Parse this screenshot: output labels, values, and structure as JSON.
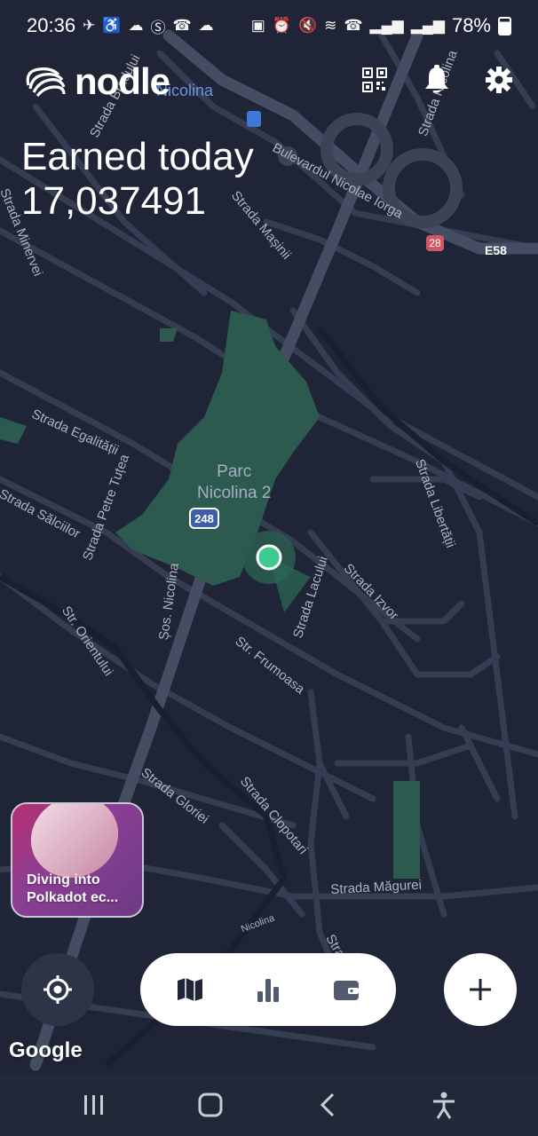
{
  "status_bar": {
    "time": "20:36",
    "left_icons": [
      "telegram-icon",
      "accessibility-icon",
      "cloud-sync-icon",
      "s-icon",
      "wifi-call-icon",
      "cloud-icon"
    ],
    "right_icons": [
      "screen-record-icon",
      "alarm-icon",
      "mute-icon",
      "wifi-icon",
      "call-icon",
      "signal-icon",
      "signal-icon-2"
    ],
    "battery": "78%"
  },
  "app": {
    "logo_text": "nodle",
    "earned_label": "Earned today",
    "earned_value": "17,037491"
  },
  "map": {
    "park_label": "Parc\nNicolina 2",
    "route_248": "248",
    "route_28": "28",
    "route_e58": "E58",
    "top_place": "Nicolina",
    "streets": [
      "Strada Bradului",
      "Bulevardul Nicolae Iorga",
      "Strada Nicolina",
      "Strada Mașinii",
      "Strada Minervei",
      "Strada Egalității",
      "Strada Sălciilor",
      "Strada Petre Tuțea",
      "Strada Libertății",
      "Strada Izvor",
      "Strada Lacului",
      "Str. Orientului",
      "Șos. Nicolina",
      "Str. Frumoasa",
      "Strada Gloriei",
      "Strada Clopotari",
      "Strada Măgurei",
      "Nicolina",
      "Stra"
    ]
  },
  "story": {
    "title": "Diving into Polkadot ec..."
  },
  "attribution": "Google",
  "tabs": [
    {
      "name": "map-icon"
    },
    {
      "name": "stats-icon"
    },
    {
      "name": "wallet-icon"
    }
  ],
  "colors": {
    "map_bg": "#1f2536",
    "road": "#3a4357",
    "park": "#2e5a4f",
    "accent": "#2ecc71"
  }
}
